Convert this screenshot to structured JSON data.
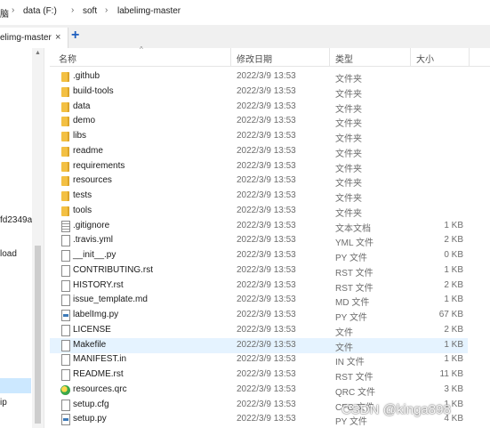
{
  "address_bar": {
    "crumbs": [
      "脑",
      "data (F:)",
      "soft",
      "labelimg-master"
    ],
    "separator": "›"
  },
  "tabs": {
    "active_label": "elimg-master",
    "close_glyph": "×",
    "new_tab_glyph": "+"
  },
  "nav": {
    "items": [
      "fd2349a",
      "load",
      "ip"
    ],
    "scroll_up": "▲"
  },
  "columns": {
    "name": "名称",
    "date": "修改日期",
    "type": "类型",
    "size": "大小",
    "sort_indicator": "^"
  },
  "files": [
    {
      "name": ".github",
      "date": "2022/3/9 13:53",
      "type": "文件夹",
      "size": "",
      "icon": "folder-icon"
    },
    {
      "name": "build-tools",
      "date": "2022/3/9 13:53",
      "type": "文件夹",
      "size": "",
      "icon": "folder-icon"
    },
    {
      "name": "data",
      "date": "2022/3/9 13:53",
      "type": "文件夹",
      "size": "",
      "icon": "folder-icon"
    },
    {
      "name": "demo",
      "date": "2022/3/9 13:53",
      "type": "文件夹",
      "size": "",
      "icon": "folder-icon"
    },
    {
      "name": "libs",
      "date": "2022/3/9 13:53",
      "type": "文件夹",
      "size": "",
      "icon": "folder-icon"
    },
    {
      "name": "readme",
      "date": "2022/3/9 13:53",
      "type": "文件夹",
      "size": "",
      "icon": "folder-icon"
    },
    {
      "name": "requirements",
      "date": "2022/3/9 13:53",
      "type": "文件夹",
      "size": "",
      "icon": "folder-icon"
    },
    {
      "name": "resources",
      "date": "2022/3/9 13:53",
      "type": "文件夹",
      "size": "",
      "icon": "folder-icon"
    },
    {
      "name": "tests",
      "date": "2022/3/9 13:53",
      "type": "文件夹",
      "size": "",
      "icon": "folder-icon"
    },
    {
      "name": "tools",
      "date": "2022/3/9 13:53",
      "type": "文件夹",
      "size": "",
      "icon": "folder-icon"
    },
    {
      "name": ".gitignore",
      "date": "2022/3/9 13:53",
      "type": "文本文档",
      "size": "1 KB",
      "icon": "text-file-icon"
    },
    {
      "name": ".travis.yml",
      "date": "2022/3/9 13:53",
      "type": "YML 文件",
      "size": "2 KB",
      "icon": "file-icon"
    },
    {
      "name": "__init__.py",
      "date": "2022/3/9 13:53",
      "type": "PY 文件",
      "size": "0 KB",
      "icon": "file-icon"
    },
    {
      "name": "CONTRIBUTING.rst",
      "date": "2022/3/9 13:53",
      "type": "RST 文件",
      "size": "1 KB",
      "icon": "file-icon"
    },
    {
      "name": "HISTORY.rst",
      "date": "2022/3/9 13:53",
      "type": "RST 文件",
      "size": "2 KB",
      "icon": "file-icon"
    },
    {
      "name": "issue_template.md",
      "date": "2022/3/9 13:53",
      "type": "MD 文件",
      "size": "1 KB",
      "icon": "file-icon"
    },
    {
      "name": "labelImg.py",
      "date": "2022/3/9 13:53",
      "type": "PY 文件",
      "size": "67 KB",
      "icon": "python-file-icon"
    },
    {
      "name": "LICENSE",
      "date": "2022/3/9 13:53",
      "type": "文件",
      "size": "2 KB",
      "icon": "file-icon"
    },
    {
      "name": "Makefile",
      "date": "2022/3/9 13:53",
      "type": "文件",
      "size": "1 KB",
      "icon": "file-icon",
      "highlighted": true
    },
    {
      "name": "MANIFEST.in",
      "date": "2022/3/9 13:53",
      "type": "IN 文件",
      "size": "1 KB",
      "icon": "file-icon"
    },
    {
      "name": "README.rst",
      "date": "2022/3/9 13:53",
      "type": "RST 文件",
      "size": "11 KB",
      "icon": "file-icon"
    },
    {
      "name": "resources.qrc",
      "date": "2022/3/9 13:53",
      "type": "QRC 文件",
      "size": "3 KB",
      "icon": "qrc-file-icon"
    },
    {
      "name": "setup.cfg",
      "date": "2022/3/9 13:53",
      "type": "CFG 文件",
      "size": "1 KB",
      "icon": "file-icon"
    },
    {
      "name": "setup.py",
      "date": "2022/3/9 13:53",
      "type": "PY 文件",
      "size": "4 KB",
      "icon": "python-file-icon"
    }
  ],
  "watermark": "CSDN @kinga898"
}
